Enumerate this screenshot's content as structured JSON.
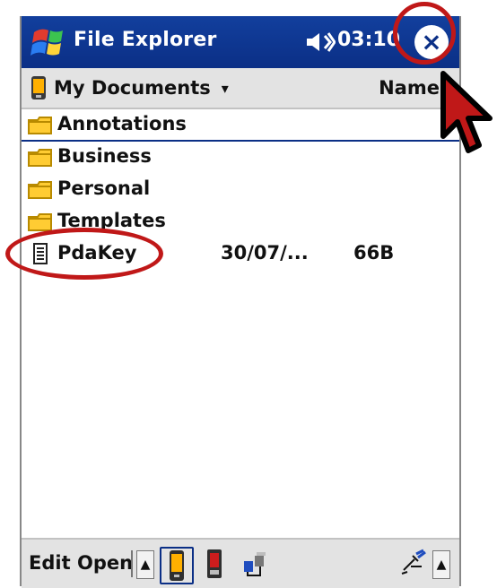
{
  "window": {
    "title": "File Explorer",
    "time": "03:10",
    "icons": {
      "start": "windows-start-icon",
      "volume": "volume-icon",
      "close": "close-icon"
    }
  },
  "header": {
    "folder_label": "My Documents",
    "folder_caret": "▾",
    "sort_label": "Name",
    "sort_caret": "▾"
  },
  "files": [
    {
      "name": "Annotations",
      "type": "folder"
    },
    {
      "name": "Business",
      "type": "folder"
    },
    {
      "name": "Personal",
      "type": "folder"
    },
    {
      "name": "Templates",
      "type": "folder"
    },
    {
      "name": "PdaKey",
      "type": "file",
      "date": "30/07/...",
      "size": "66B"
    }
  ],
  "toolbar": {
    "edit_label": "Edit",
    "open_label": "Open",
    "up_arrow": "▲",
    "input_arrow": "▲",
    "icons": [
      "pda-icon",
      "card-icon",
      "network-icon",
      "input-panel-icon"
    ]
  },
  "colors": {
    "titlebar": "#123f9d",
    "annotation": "#c01818",
    "selection": "#0b2f86"
  }
}
